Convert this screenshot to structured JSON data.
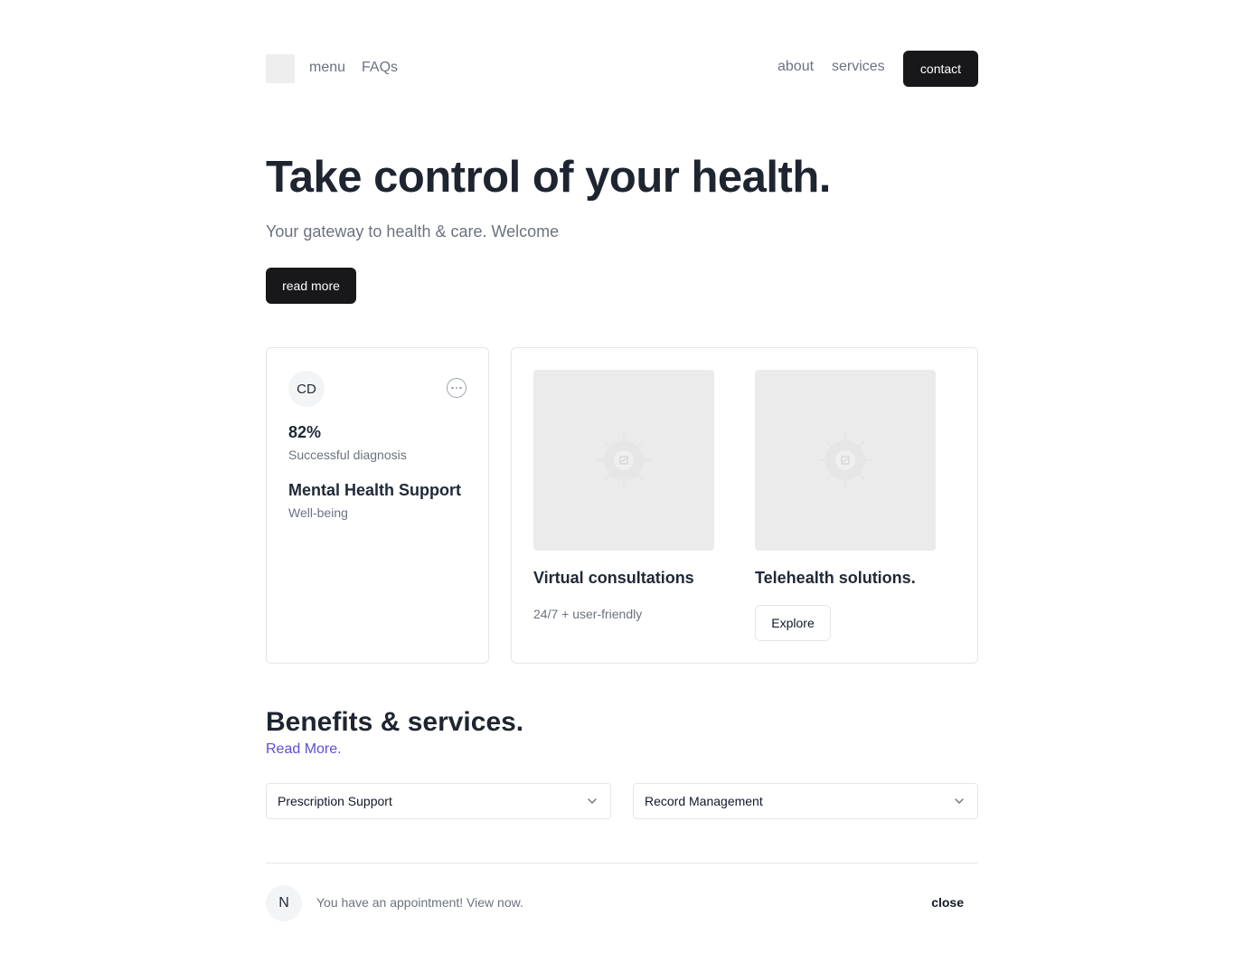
{
  "nav": {
    "left_links": [
      "menu",
      "FAQs"
    ],
    "right_links": [
      "about",
      "services"
    ],
    "contact_label": "contact"
  },
  "hero": {
    "title": "Take control of your health.",
    "subtitle": "Your gateway to health & care. Welcome",
    "button_label": "read more"
  },
  "stat_card": {
    "avatar_initials": "CD",
    "menu_icon": "more-horizontal-icon",
    "stat_value": "82%",
    "stat_label": "Successful diagnosis",
    "title": "Mental Health Support",
    "subtitle": "Well-being"
  },
  "features": {
    "items": [
      {
        "title": "Virtual consultations",
        "subtitle": "24/7 + user-friendly",
        "image_icon": "image-placeholder-icon"
      },
      {
        "title": "Telehealth solutions.",
        "button_label": "Explore",
        "image_icon": "image-placeholder-icon"
      }
    ]
  },
  "benefits": {
    "title": "Benefits & services.",
    "link_label": "Read More.",
    "selects": [
      {
        "label": "Prescription Support",
        "icon": "chevron-down-icon"
      },
      {
        "label": "Record Management",
        "icon": "chevron-down-icon"
      }
    ]
  },
  "notification": {
    "avatar_initial": "N",
    "text": "You have an appointment! View now.",
    "close_label": "close"
  },
  "colors": {
    "dark_button": "#18181b",
    "link_accent": "#5b4fd6",
    "muted_text": "#6b7280",
    "border": "#e5e7eb"
  }
}
